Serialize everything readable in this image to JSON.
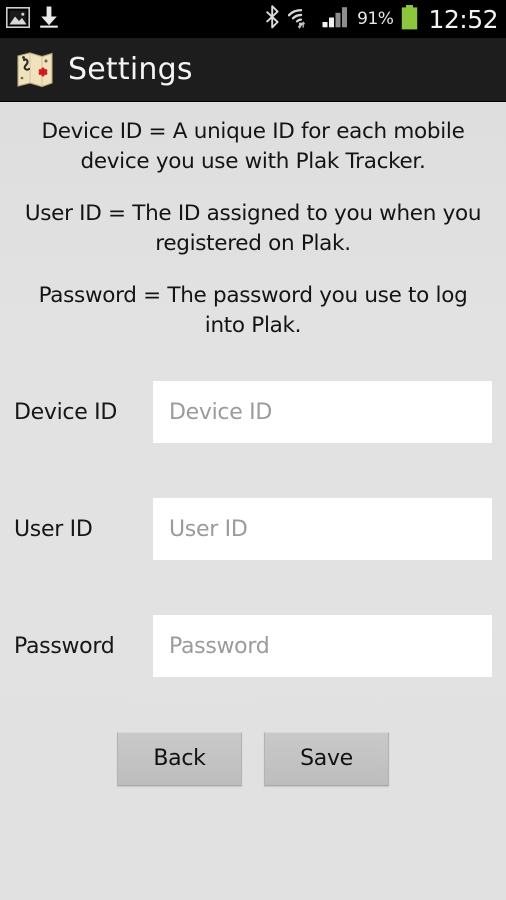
{
  "status_bar": {
    "left_icons": [
      {
        "name": "gallery-image-icon",
        "glyph": "image"
      },
      {
        "name": "download-icon",
        "glyph": "download"
      }
    ],
    "right_icons": [
      {
        "name": "bluetooth-icon",
        "glyph": "bluetooth"
      },
      {
        "name": "wifi-icon",
        "glyph": "wifi"
      },
      {
        "name": "cellular-signal-icon",
        "glyph": "signal"
      }
    ],
    "battery_percent": "91%",
    "battery_color": "#8cc63e",
    "clock": "12:52",
    "background_color": "#000000"
  },
  "title_bar": {
    "icon_name": "treasure-map-app-icon",
    "title": "Settings",
    "background_color": "#1d1d1d",
    "text_color": "#f4f4f4"
  },
  "intro": {
    "paragraphs": [
      "Device ID = A unique ID for each mobile device you use with Plak Tracker.",
      "User ID = The ID assigned to you when you registered on Plak.",
      "Password = The password you use to log into Plak."
    ]
  },
  "form": {
    "fields": [
      {
        "label": "Device ID",
        "placeholder": "Device ID",
        "value": "",
        "type": "text"
      },
      {
        "label": "User ID",
        "placeholder": "User ID",
        "value": "",
        "type": "text"
      },
      {
        "label": "Password",
        "placeholder": "Password",
        "value": "",
        "type": "text"
      }
    ]
  },
  "buttons": {
    "back_label": "Back",
    "save_label": "Save"
  },
  "theme": {
    "page_background": "#e1e1e1",
    "input_background": "#ffffff",
    "placeholder_color": "#9b9b9b",
    "button_background": "#c3c3c3"
  }
}
